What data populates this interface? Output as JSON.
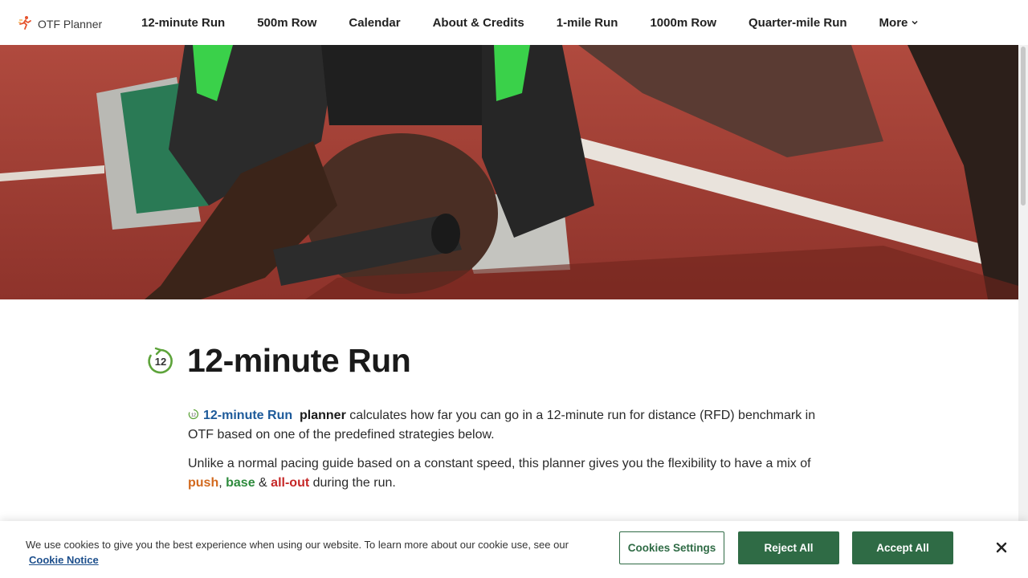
{
  "brand": {
    "name": "OTF Planner",
    "logo_icon": "runner-icon"
  },
  "nav": {
    "items": [
      "12-minute Run",
      "500m Row",
      "Calendar",
      "About & Credits",
      "1-mile Run",
      "1000m Row",
      "Quarter-mile Run"
    ],
    "more_label": "More"
  },
  "page": {
    "title": "12-minute Run",
    "title_icon": "timer-12-icon",
    "title_icon_text": "12"
  },
  "intro": {
    "run_link": "12-minute Run",
    "planner_word": "planner",
    "p1_rest": "calculates how far you can go in a 12-minute run for distance (RFD) benchmark in OTF based on one of the predefined strategies below.",
    "p2_start": "Unlike a normal pacing guide based on a constant speed, this planner gives you the flexibility to have a mix of",
    "push": "push",
    "comma": ",",
    "base": "base",
    "amp": "&",
    "allout": "all-out",
    "p2_end": "during the run."
  },
  "cookie": {
    "text": "We use cookies to give you the best experience when using our website. To learn more about our cookie use, see our",
    "link": "Cookie Notice",
    "settings_label": "Cookies Settings",
    "reject_label": "Reject All",
    "accept_label": "Accept All"
  },
  "colors": {
    "accent_green": "#2f6b45",
    "link_blue": "#1d5a9a",
    "push": "#d2691e",
    "base": "#2e8b3d",
    "allout": "#c62828",
    "track": "#9c3a30"
  }
}
